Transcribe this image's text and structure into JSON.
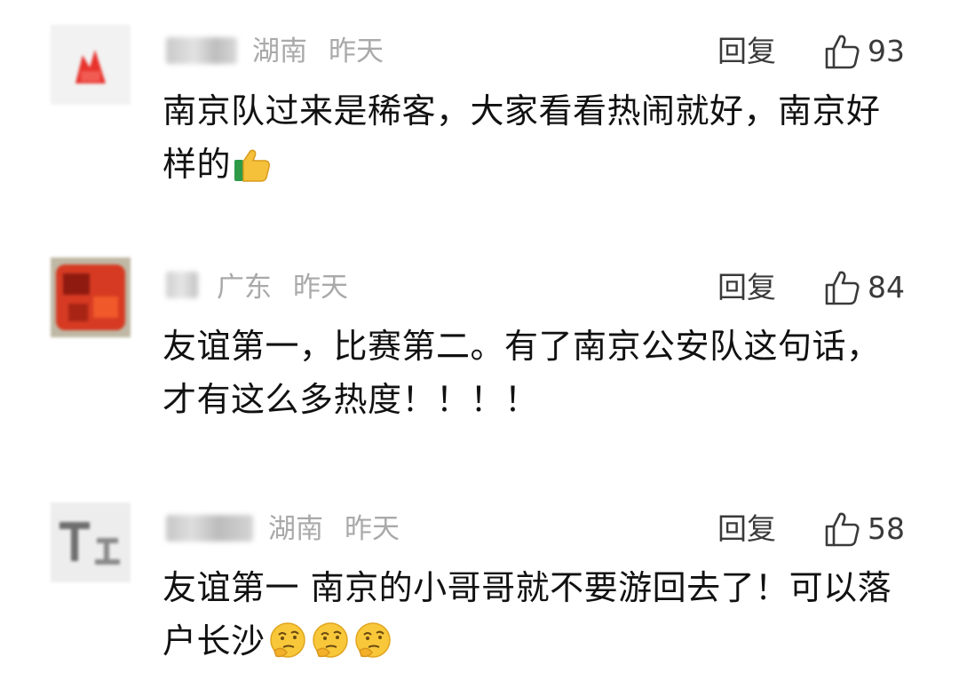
{
  "comments": [
    {
      "region": "湖南",
      "time": "昨天",
      "reply_label": "回复",
      "likes": "93",
      "content": "南京队过来是稀客，大家看看热闹就好，南京好样的",
      "emoji": "thumbs-up-emoji"
    },
    {
      "region": "广东",
      "time": "昨天",
      "reply_label": "回复",
      "likes": "84",
      "content": "友谊第一，比赛第二。有了南京公安队这句话，才有这么多热度！！！！",
      "emoji": ""
    },
    {
      "region": "湖南",
      "time": "昨天",
      "reply_label": "回复",
      "likes": "58",
      "content": "友谊第一 南京的小哥哥就不要游回去了！可以落户长沙",
      "emoji": "thinking-face-emoji x3"
    }
  ],
  "colors": {
    "text": "#111111",
    "meta": "#a9a9a9",
    "action": "#3a3a3a",
    "background": "#ffffff"
  }
}
